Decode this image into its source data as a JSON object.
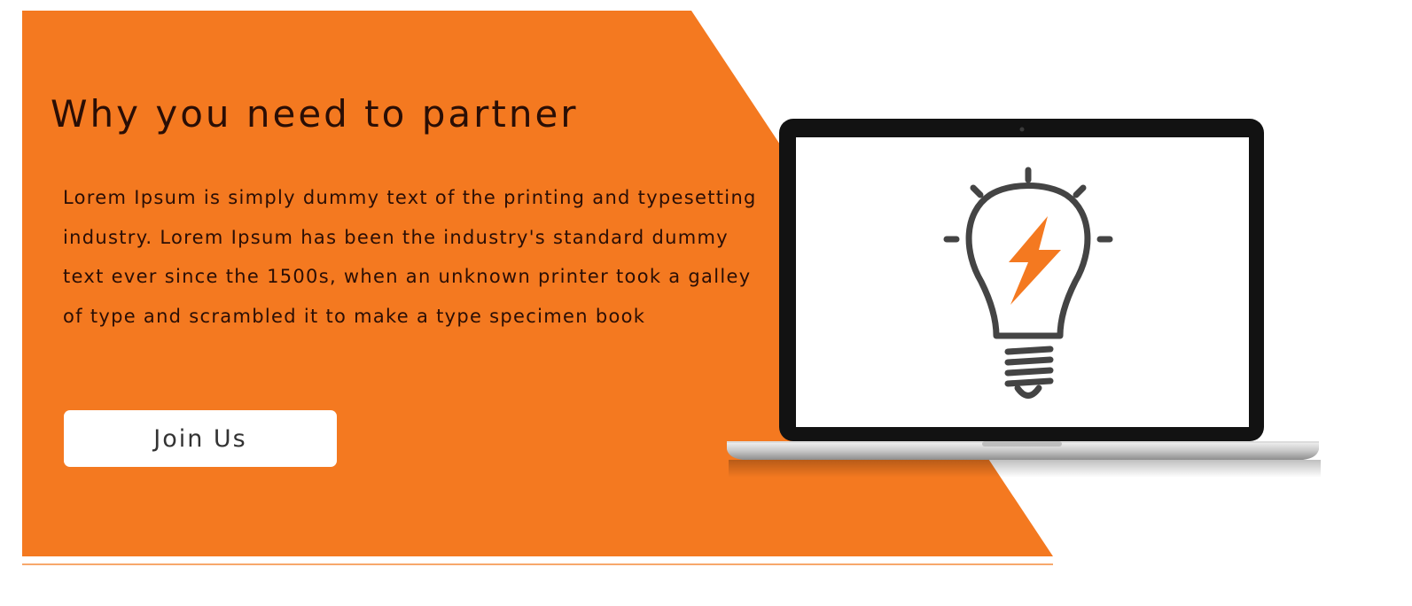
{
  "hero": {
    "title": "Why you need to partner",
    "body": "Lorem Ipsum is simply dummy text of the printing and typesetting industry. Lorem Ipsum has been the industry's standard dummy text ever since the 1500s, when an unknown printer took a galley of type and scrambled it to make a type specimen book",
    "cta_label": "Join Us"
  },
  "illustration": {
    "device": "laptop",
    "icon": "lightbulb-icon",
    "inner_icon": "lightning-bolt-icon"
  },
  "colors": {
    "accent": "#f47920",
    "text_dark": "#2a0e05",
    "button_bg": "#ffffff",
    "icon_gray": "#444444"
  }
}
